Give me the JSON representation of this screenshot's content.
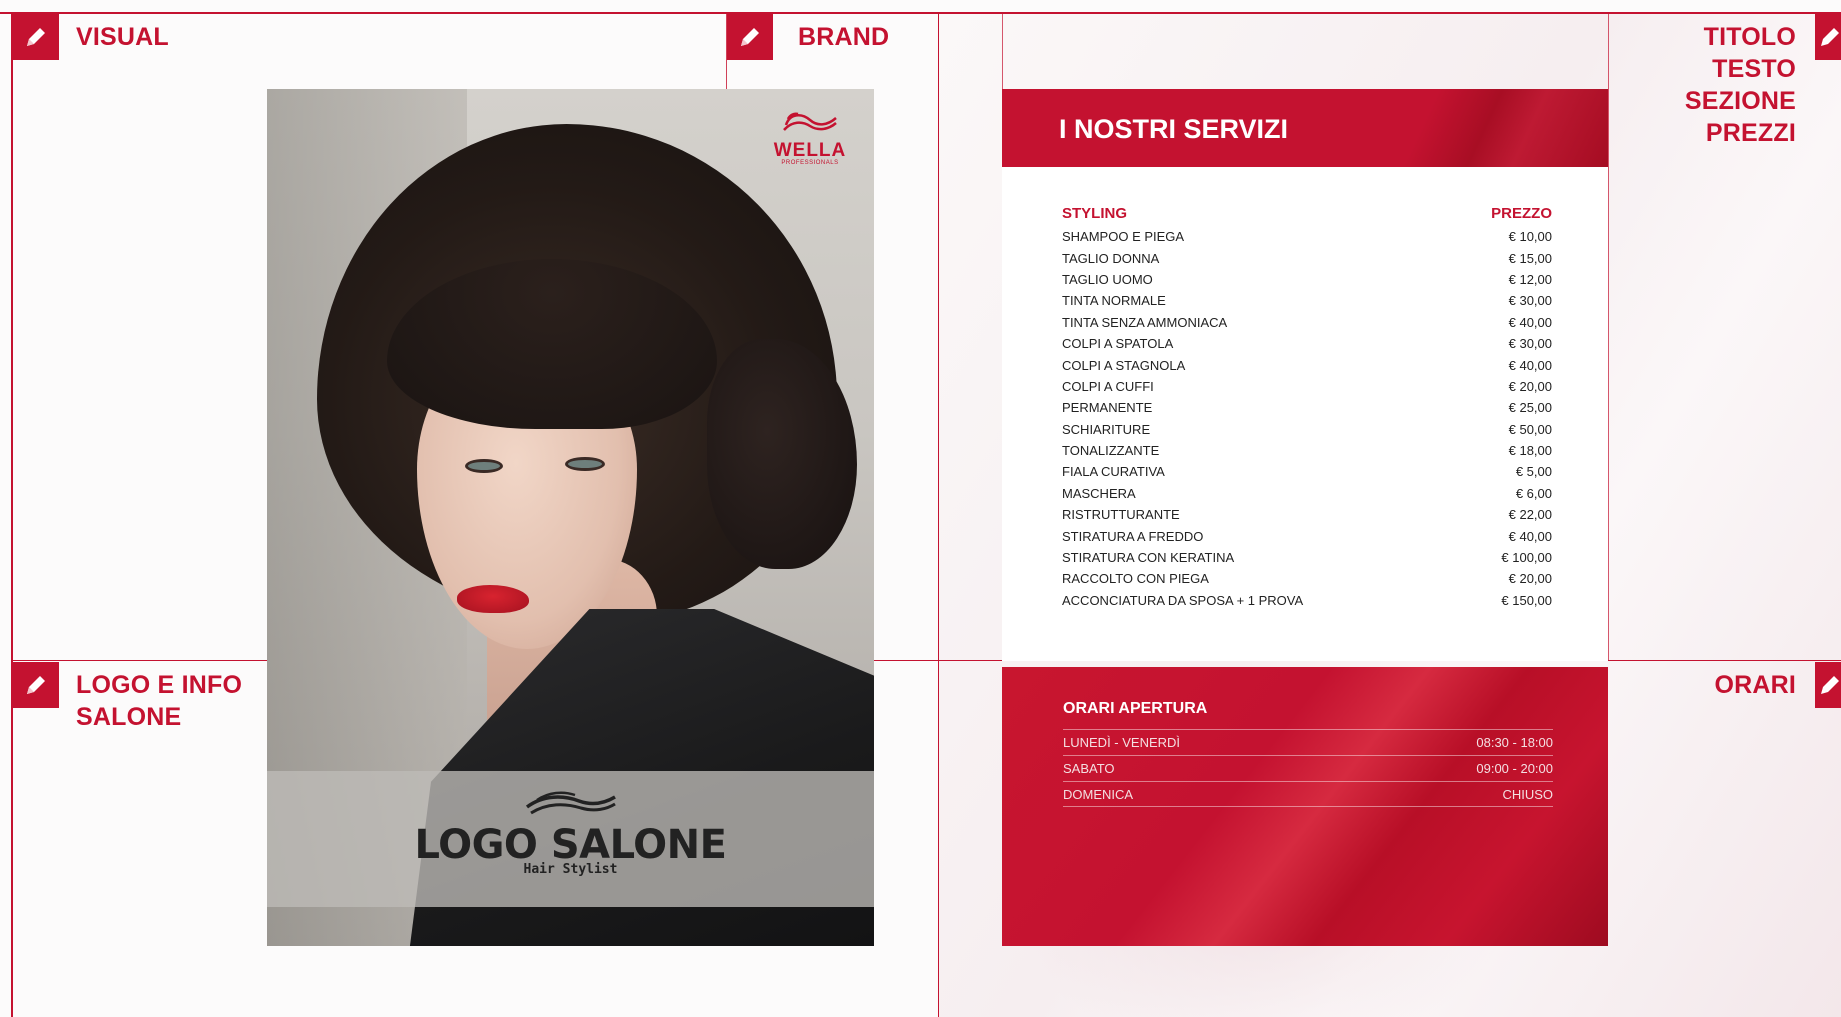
{
  "labels": {
    "visual": "VISUAL",
    "brand": "BRAND",
    "logo_line1": "LOGO E INFO",
    "logo_line2": "SALONE",
    "titolo_line1": "TITOLO",
    "titolo_line2": "TESTO",
    "titolo_line3": "SEZIONE",
    "titolo_line4": "PREZZI",
    "orari": "ORARI"
  },
  "poster": {
    "brand_text": "WELLA",
    "brand_sub": "PROFESSIONALS",
    "salon_name": "LOGO SALONE",
    "salon_tagline": "Hair Stylist"
  },
  "services": {
    "title": "I NOSTRI SERVIZI",
    "category": "STYLING",
    "price_header": "PREZZO",
    "items": [
      {
        "name": "SHAMPOO E PIEGA",
        "price": "€ 10,00"
      },
      {
        "name": "TAGLIO DONNA",
        "price": "€ 15,00"
      },
      {
        "name": "TAGLIO UOMO",
        "price": "€ 12,00"
      },
      {
        "name": "TINTA NORMALE",
        "price": "€ 30,00"
      },
      {
        "name": "TINTA SENZA AMMONIACA",
        "price": "€ 40,00"
      },
      {
        "name": "COLPI A SPATOLA",
        "price": "€ 30,00"
      },
      {
        "name": "COLPI A STAGNOLA",
        "price": "€ 40,00"
      },
      {
        "name": "COLPI A CUFFI",
        "price": "€ 20,00"
      },
      {
        "name": "PERMANENTE",
        "price": "€ 25,00"
      },
      {
        "name": "SCHIARITURE",
        "price": "€ 50,00"
      },
      {
        "name": "TONALIZZANTE",
        "price": "€ 18,00"
      },
      {
        "name": "FIALA CURATIVA",
        "price": "€ 5,00"
      },
      {
        "name": "MASCHERA",
        "price": "€ 6,00"
      },
      {
        "name": "RISTRUTTURANTE",
        "price": "€ 22,00"
      },
      {
        "name": "STIRATURA A FREDDO",
        "price": "€ 40,00"
      },
      {
        "name": "STIRATURA CON KERATINA",
        "price": "€ 100,00"
      },
      {
        "name": "RACCOLTO CON PIEGA",
        "price": "€ 20,00"
      },
      {
        "name": "ACCONCIATURA DA SPOSA + 1 PROVA",
        "price": "€ 150,00"
      }
    ]
  },
  "hours": {
    "title": "ORARI APERTURA",
    "rows": [
      {
        "day": "LUNEDÌ - VENERDÌ",
        "time": "08:30 - 18:00"
      },
      {
        "day": "SABATO",
        "time": "09:00 - 20:00"
      },
      {
        "day": "DOMENICA",
        "time": "CHIUSO"
      }
    ]
  },
  "colors": {
    "accent": "#c41230",
    "text_dark": "#222222",
    "white": "#ffffff"
  },
  "icons": {
    "edit": "pencil-icon"
  }
}
